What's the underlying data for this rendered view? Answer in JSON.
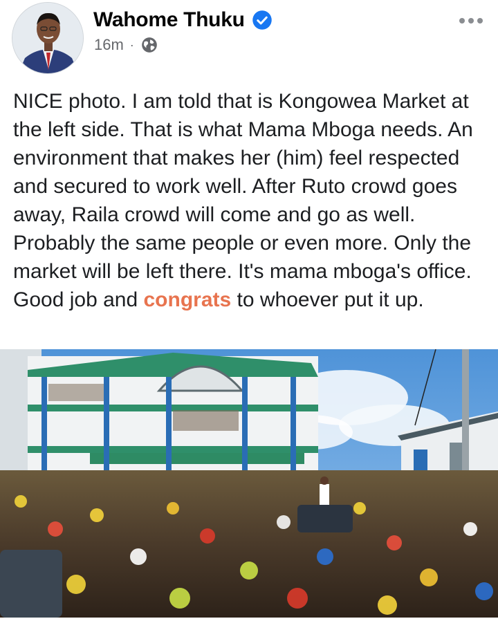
{
  "post": {
    "author": "Wahome Thuku",
    "timestamp": "16m",
    "meta_separator": "·",
    "audience_icon": "globe-icon",
    "verified_icon": "verified-badge-icon",
    "more_icon": "more-options-icon",
    "text_before": "NICE photo. I am told that is Kongowea Market at the left side. That is what Mama Mboga needs. An environment that makes her (him) feel respected and secured to work well. After Ruto crowd goes away, Raila crowd will come and go as well. Probably the same people or even more. Only the market will be left there. It's mama mboga's office. Good job and ",
    "highlight": "congrats",
    "text_after": " to whoever put it up."
  },
  "colors": {
    "highlight": "#e8744f",
    "verified": "#1877f2",
    "meta": "#65676b"
  }
}
